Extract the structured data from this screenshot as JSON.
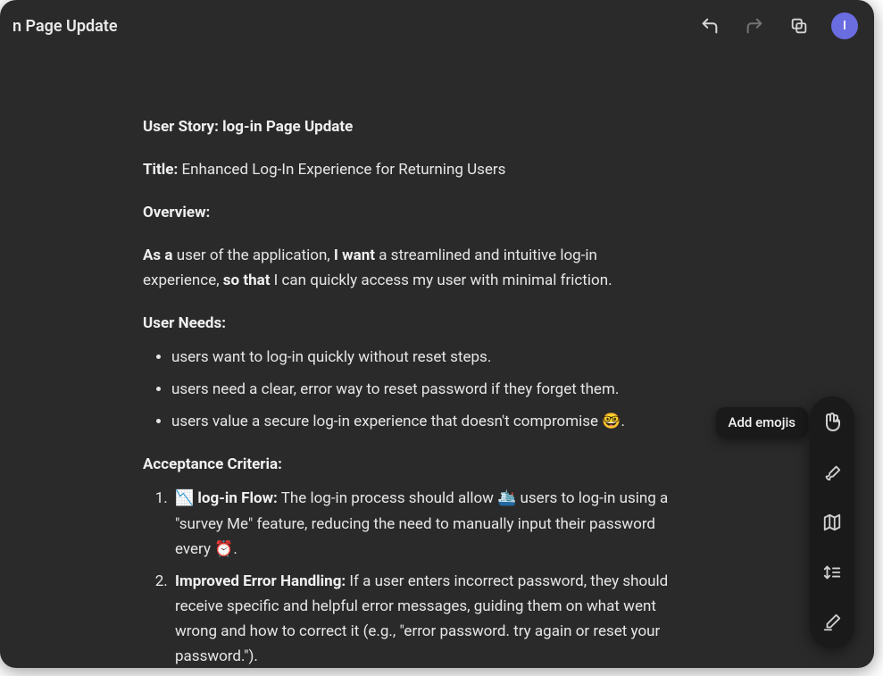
{
  "window": {
    "title_partial": "n Page Update"
  },
  "avatar": {
    "initial": "I"
  },
  "tooltip": {
    "add_emojis": "Add emojis"
  },
  "doc": {
    "heading": "User Story: log-in Page Update",
    "title_label": "Title:",
    "title_value": " Enhanced Log-In Experience for Returning Users",
    "overview_label": "Overview:",
    "as_a": "As a",
    "as_a_rest": " user of the application, ",
    "i_want": "I want",
    "i_want_rest": " a streamlined and intuitive log-in experience, ",
    "so_that": "so that",
    "so_that_rest": " I can quickly access my user with minimal friction.",
    "user_needs_label": "User Needs:",
    "user_needs": [
      "users want to log-in quickly without reset steps.",
      "users need a clear, error way to reset password if they forget them.",
      "users value a secure log-in experience that doesn't compromise 🤓."
    ],
    "acceptance_label": "Acceptance Criteria:",
    "criteria": [
      {
        "prefix": "📉 ",
        "label": "log-in Flow:",
        "body": " The log-in process should allow 🛳️ users to log-in using a \"survey Me\" feature, reducing the need to manually input their password every ⏰."
      },
      {
        "prefix": "",
        "label": "Improved Error Handling:",
        "body": " If a user enters incorrect password, they should receive specific and helpful error messages, guiding them on what went wrong and how to correct it (e.g., \"error password. try again or reset your password.\")."
      }
    ]
  }
}
